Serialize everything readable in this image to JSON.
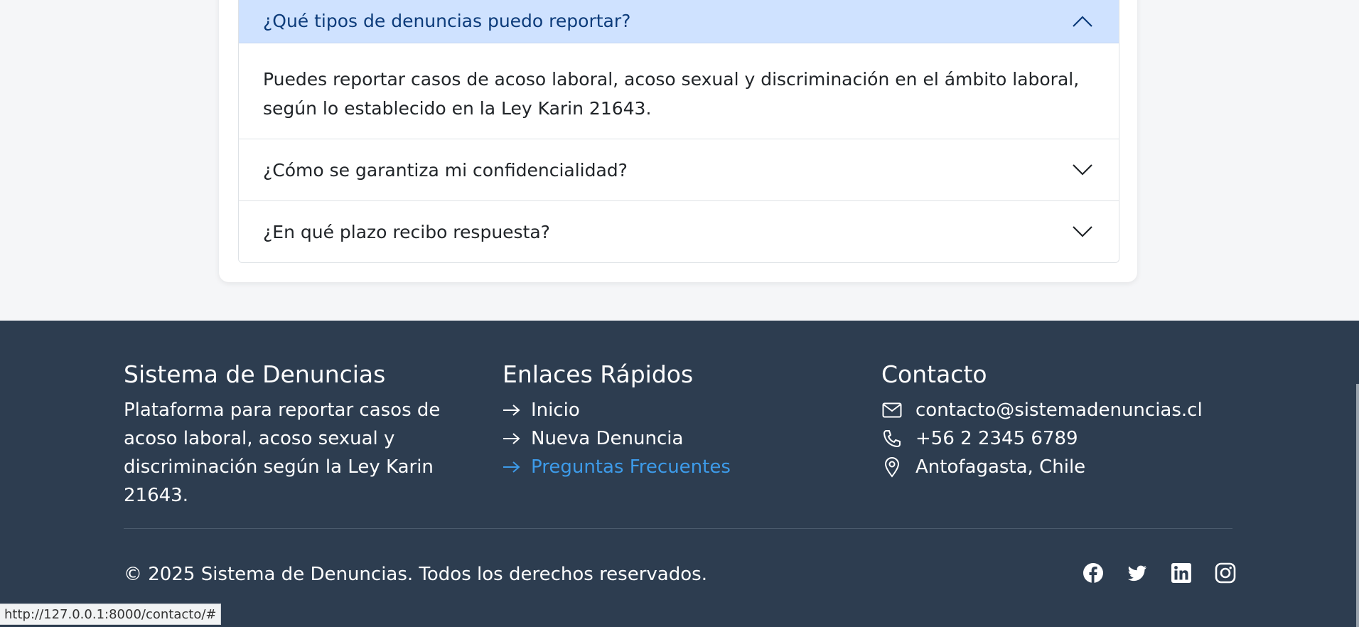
{
  "faq": {
    "items": [
      {
        "question": "¿Qué tipos de denuncias puedo reportar?",
        "answer": "Puedes reportar casos de acoso laboral, acoso sexual y discriminación en el ámbito laboral, según lo establecido en la Ley Karin 21643.",
        "expanded": true
      },
      {
        "question": "¿Cómo se garantiza mi confidencialidad?",
        "expanded": false
      },
      {
        "question": "¿En qué plazo recibo respuesta?",
        "expanded": false
      }
    ]
  },
  "footer": {
    "about": {
      "title": "Sistema de Denuncias",
      "description": "Plataforma para reportar casos de acoso laboral, acoso sexual y discriminación según la Ley Karin 21643."
    },
    "links": {
      "title": "Enlaces Rápidos",
      "items": [
        "Inicio",
        "Nueva Denuncia",
        "Preguntas Frecuentes"
      ],
      "active_color": "#3d9be9"
    },
    "contact": {
      "title": "Contacto",
      "email": "contacto@sistemadenuncias.cl",
      "phone": "+56 2 2345 6789",
      "location": "Antofagasta, Chile"
    },
    "copyright": "© 2025 Sistema de Denuncias. Todos los derechos reservados.",
    "social_icons": [
      "facebook-icon",
      "twitter-icon",
      "linkedin-icon",
      "instagram-icon"
    ],
    "background": "#2d3d50"
  },
  "status_bar": {
    "url": "http://127.0.0.1:8000/contacto/#"
  }
}
